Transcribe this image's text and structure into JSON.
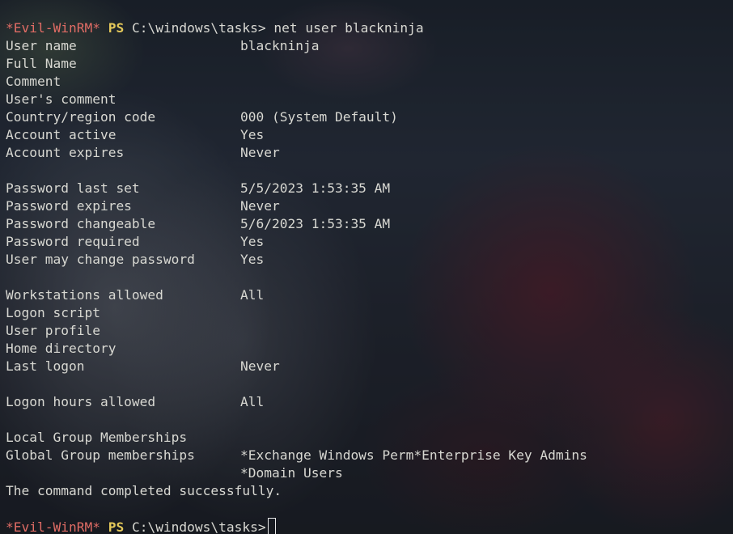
{
  "prompt": {
    "host": "*Evil-WinRM*",
    "shell": "PS",
    "path": "C:\\windows\\tasks>"
  },
  "command": "net user blackninja",
  "fields": {
    "user_name": {
      "label": "User name",
      "value": "blackninja"
    },
    "full_name": {
      "label": "Full Name",
      "value": ""
    },
    "comment": {
      "label": "Comment",
      "value": ""
    },
    "users_comment": {
      "label": "User's comment",
      "value": ""
    },
    "country_code": {
      "label": "Country/region code",
      "value": "000 (System Default)"
    },
    "account_active": {
      "label": "Account active",
      "value": "Yes"
    },
    "account_expires": {
      "label": "Account expires",
      "value": "Never"
    },
    "password_last_set": {
      "label": "Password last set",
      "value": "5/5/2023 1:53:35 AM"
    },
    "password_expires": {
      "label": "Password expires",
      "value": "Never"
    },
    "password_changeable": {
      "label": "Password changeable",
      "value": "5/6/2023 1:53:35 AM"
    },
    "password_required": {
      "label": "Password required",
      "value": "Yes"
    },
    "user_may_change_password": {
      "label": "User may change password",
      "value": "Yes"
    },
    "workstations_allowed": {
      "label": "Workstations allowed",
      "value": "All"
    },
    "logon_script": {
      "label": "Logon script",
      "value": ""
    },
    "user_profile": {
      "label": "User profile",
      "value": ""
    },
    "home_directory": {
      "label": "Home directory",
      "value": ""
    },
    "last_logon": {
      "label": "Last logon",
      "value": "Never"
    },
    "logon_hours_allowed": {
      "label": "Logon hours allowed",
      "value": "All"
    },
    "local_group_memberships": {
      "label": "Local Group Memberships",
      "value": ""
    },
    "global_group_memberships": {
      "label": "Global Group memberships",
      "value": "*Exchange Windows Perm*Enterprise Key Admins",
      "value_cont": "*Domain Users"
    }
  },
  "completion_message": "The command completed successfully.",
  "colors": {
    "prompt_host": "#e06c65",
    "prompt_ps": "#e5c95a",
    "text": "#d8d8d2"
  }
}
